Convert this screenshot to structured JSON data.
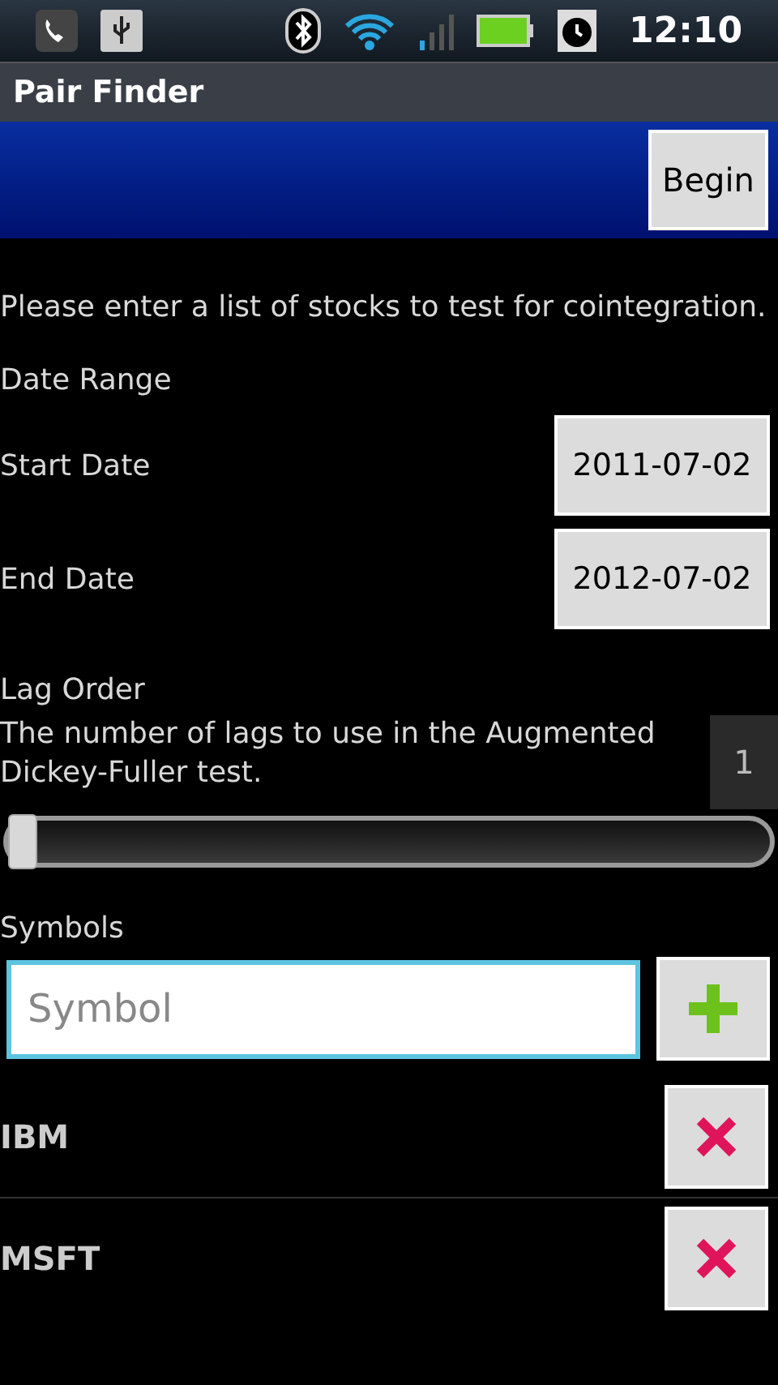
{
  "status_bar": {
    "time": "12:10"
  },
  "title_bar": {
    "title": "Pair Finder"
  },
  "toolbar": {
    "begin_button": "Begin"
  },
  "intro": "Please enter a list of stocks to test for cointegration.",
  "date_range": {
    "heading": "Date Range",
    "fields": [
      {
        "label": "Start Date",
        "value": "2011-07-02"
      },
      {
        "label": "End Date",
        "value": "2012-07-02"
      }
    ]
  },
  "lag_order": {
    "heading": "Lag Order",
    "description": "The number of lags to use in the Augmented Dickey-Fuller test.",
    "value": "1",
    "level": 0
  },
  "symbols": {
    "heading": "Symbols",
    "placeholder": "Symbol",
    "items": [
      {
        "label": "IBM"
      },
      {
        "label": "MSFT"
      }
    ]
  }
}
